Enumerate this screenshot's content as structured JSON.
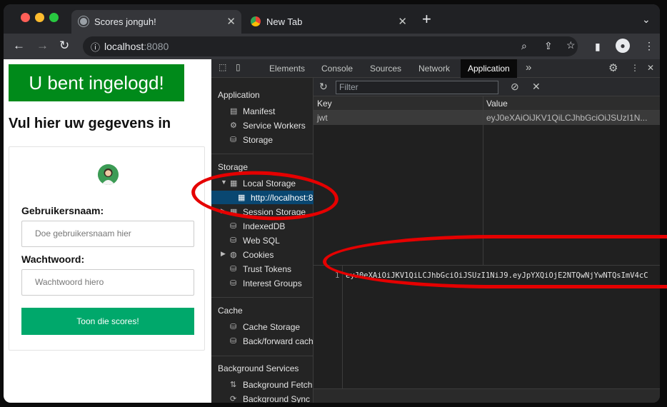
{
  "browser": {
    "tabs": [
      {
        "title": "Scores jonguh!"
      },
      {
        "title": "New Tab"
      }
    ],
    "new_tab": "+",
    "url_host": "localhost",
    "url_port": ":8080",
    "colors": {
      "close": "#ff5f57",
      "minimize": "#febc2e",
      "maximize": "#28c840"
    }
  },
  "page": {
    "banner": "U bent ingelogd!",
    "heading": "Vul hier uw gegevens in",
    "username_label": "Gebruikersnaam:",
    "username_placeholder": "Doe gebruikersnaam hier",
    "password_label": "Wachtwoord:",
    "password_placeholder": "Wachtwoord hiero",
    "button": "Toon die scores!",
    "colors": {
      "banner": "#008a1a",
      "button": "#00a86b"
    }
  },
  "devtools": {
    "tabs": [
      "Elements",
      "Console",
      "Sources",
      "Network",
      "Application"
    ],
    "selected_tab": "Application",
    "sections": {
      "application": {
        "title": "Application",
        "items": [
          "Manifest",
          "Service Workers",
          "Storage"
        ]
      },
      "storage": {
        "title": "Storage",
        "items": [
          "Local Storage",
          "http://localhost:8",
          "Session Storage",
          "IndexedDB",
          "Web SQL",
          "Cookies",
          "Trust Tokens",
          "Interest Groups"
        ]
      },
      "cache": {
        "title": "Cache",
        "items": [
          "Cache Storage",
          "Back/forward cach"
        ]
      },
      "background": {
        "title": "Background Services",
        "items": [
          "Background Fetch",
          "Background Sync"
        ]
      }
    },
    "filter_placeholder": "Filter",
    "table": {
      "headers": [
        "Key",
        "Value"
      ],
      "rows": [
        {
          "key": "jwt",
          "value": "eyJ0eXAiOiJKV1QiLCJhbGciOiJSUzI1N..."
        }
      ]
    },
    "preview": {
      "line_number": "1",
      "text": "eyJ0eXAiOiJKV1QiLCJhbGciOiJSUzI1NiJ9.eyJpYXQiOjE2NTQwNjYwNTQsImV4cC"
    }
  }
}
